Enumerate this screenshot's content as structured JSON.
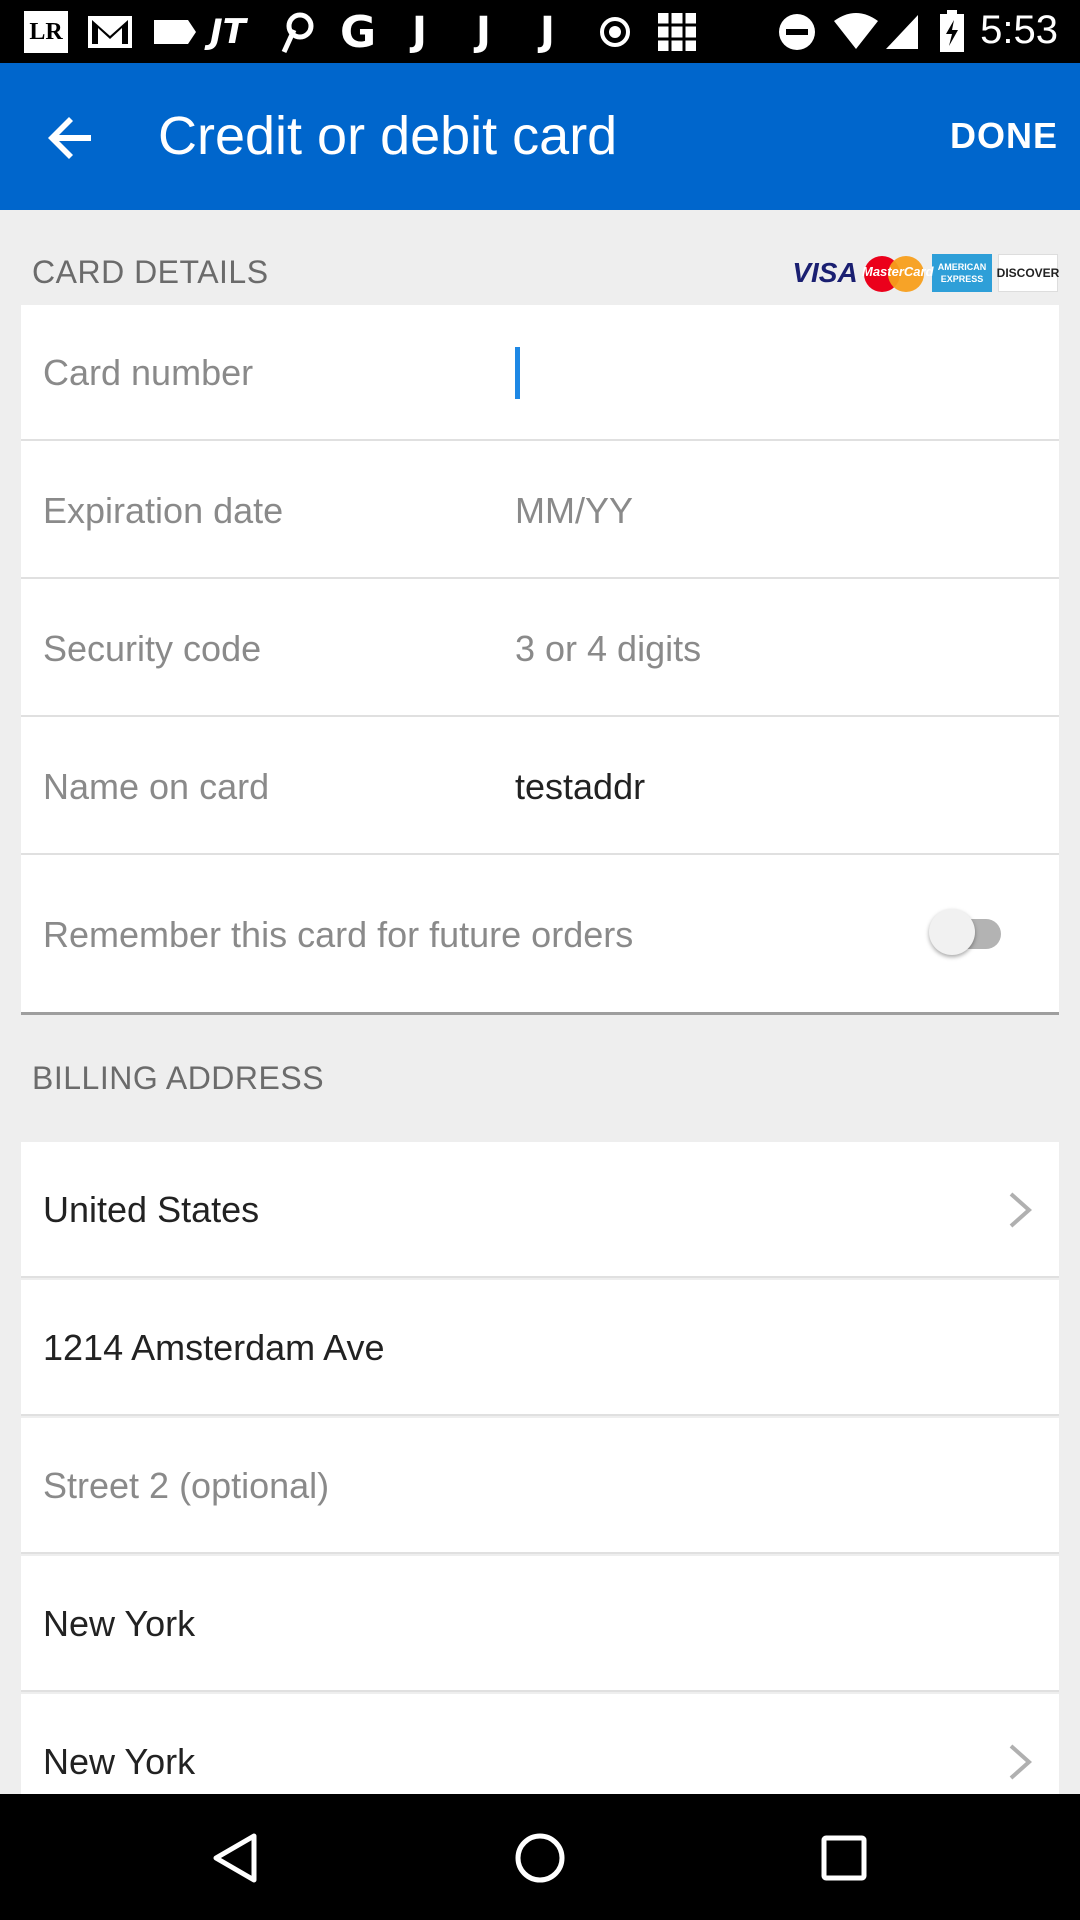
{
  "status_bar": {
    "time": "5:53",
    "left_icons": [
      "lr-app-icon",
      "gmail-icon",
      "tag-icon",
      "jt-app-icon",
      "pinterest-icon",
      "google-icon",
      "j-app-icon",
      "j-app-icon",
      "j-app-icon",
      "record-icon",
      "grid-app-icon"
    ],
    "lr_text": "LR",
    "jt_text": "JT",
    "g_text": "G",
    "j_text": "J"
  },
  "app_bar": {
    "title": "Credit or debit card",
    "done_label": "DONE",
    "background": "#0066cc"
  },
  "card_details": {
    "header": "CARD DETAILS",
    "logos": {
      "visa": "VISA",
      "mastercard": "MasterCard",
      "amex": "AMERICAN EXPRESS",
      "discover": "DISCOVER"
    },
    "fields": [
      {
        "label": "Card number",
        "value": "",
        "placeholder": ""
      },
      {
        "label": "Expiration date",
        "value": "",
        "placeholder": "MM/YY"
      },
      {
        "label": "Security code",
        "value": "",
        "placeholder": "3 or 4 digits"
      },
      {
        "label": "Name on card",
        "value": "testaddr",
        "placeholder": ""
      }
    ],
    "remember_label": "Remember this card for future orders",
    "remember_enabled": false
  },
  "billing_address": {
    "header": "BILLING ADDRESS",
    "country": "United States",
    "street1": "1214 Amsterdam Ave",
    "street2_placeholder": "Street 2 (optional)",
    "city": "New York",
    "state": "New York"
  }
}
